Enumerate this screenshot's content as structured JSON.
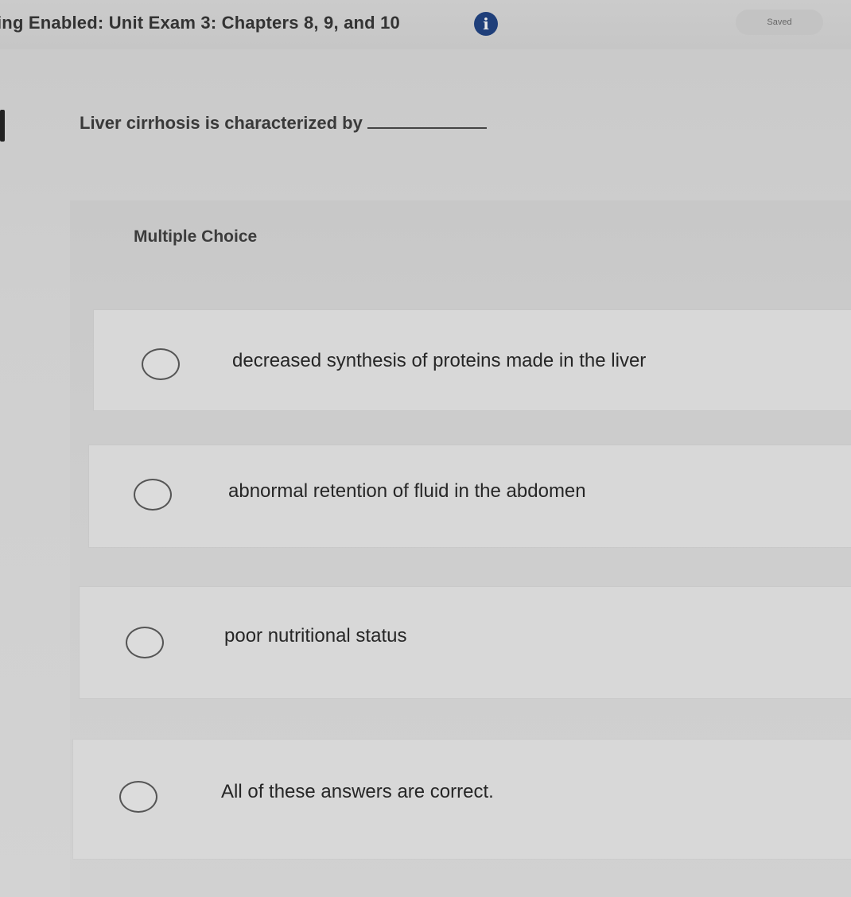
{
  "header": {
    "title": "ing Enabled: Unit Exam 3: Chapters 8, 9, and 10",
    "info_icon": "info-icon",
    "saved_label": "Saved"
  },
  "question": {
    "text": "Liver cirrhosis is characterized by",
    "type_label": "Multiple Choice",
    "choices": [
      {
        "label": "decreased synthesis of proteins made in the liver",
        "selected": false
      },
      {
        "label": "abnormal retention of fluid in the abdomen",
        "selected": false
      },
      {
        "label": "poor nutritional status",
        "selected": false
      },
      {
        "label": "All of these answers are correct.",
        "selected": false
      }
    ]
  },
  "colors": {
    "background": "#cccccc",
    "info_icon": "#1f3f7a",
    "text": "#2a2a2a"
  }
}
